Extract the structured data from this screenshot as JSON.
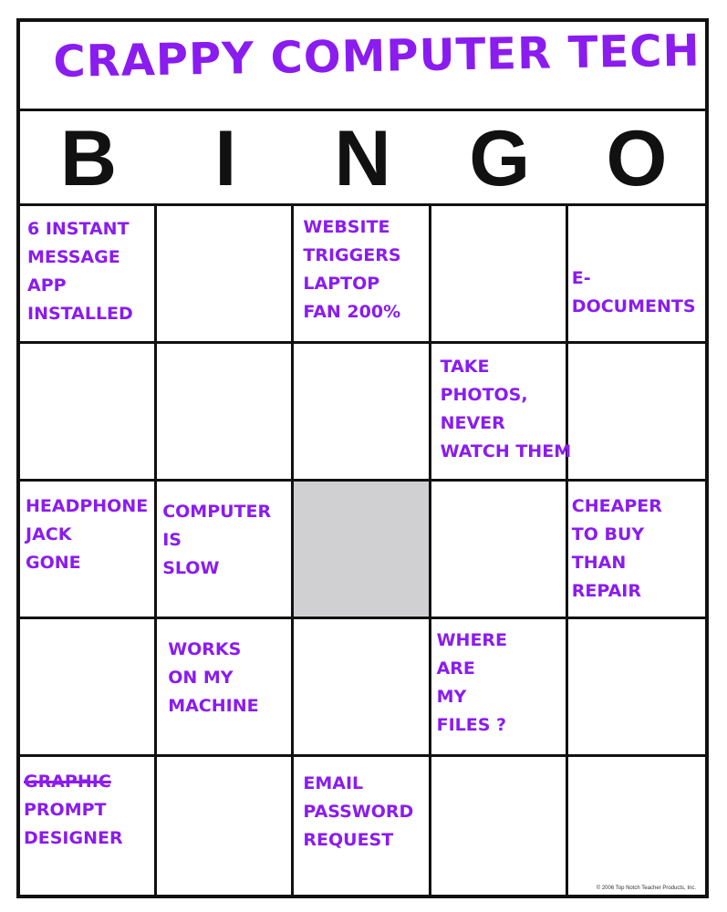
{
  "title": "CRAPPY COMPUTER TECH",
  "header_letters": [
    "B",
    "I",
    "N",
    "G",
    "O"
  ],
  "ink_color": "#8a1cf0",
  "free_cell_color": "#d0d0d2",
  "cells": [
    [
      "6 INSTANT\nMESSAGE\nAPP\nINSTALLED",
      "",
      "WEBSITE\nTRIGGERS\nLAPTOP\nFAN 200%",
      "",
      "\n\nE-\nDOCUMENTS"
    ],
    [
      "",
      "",
      "",
      "TAKE\nPHOTOS,\nNEVER\nWATCH THEM",
      ""
    ],
    [
      "HEADPHONE\nJACK\nGONE",
      "COMPUTER\nIS\nSLOW",
      "",
      "",
      "CHEAPER\nTO BUY\nTHAN\nREPAIR"
    ],
    [
      "",
      "WORKS\nON MY\nMACHINE",
      "",
      "WHERE\nARE\nMY\nFILES ?",
      ""
    ],
    [
      "GRAPHIC\nPROMPT\nDESIGNER",
      "",
      "EMAIL\nPASSWORD\nREQUEST",
      "",
      ""
    ]
  ],
  "struck_word": "GRAPHIC",
  "copyright": "© 2006 Top Notch Teacher Products, Inc."
}
